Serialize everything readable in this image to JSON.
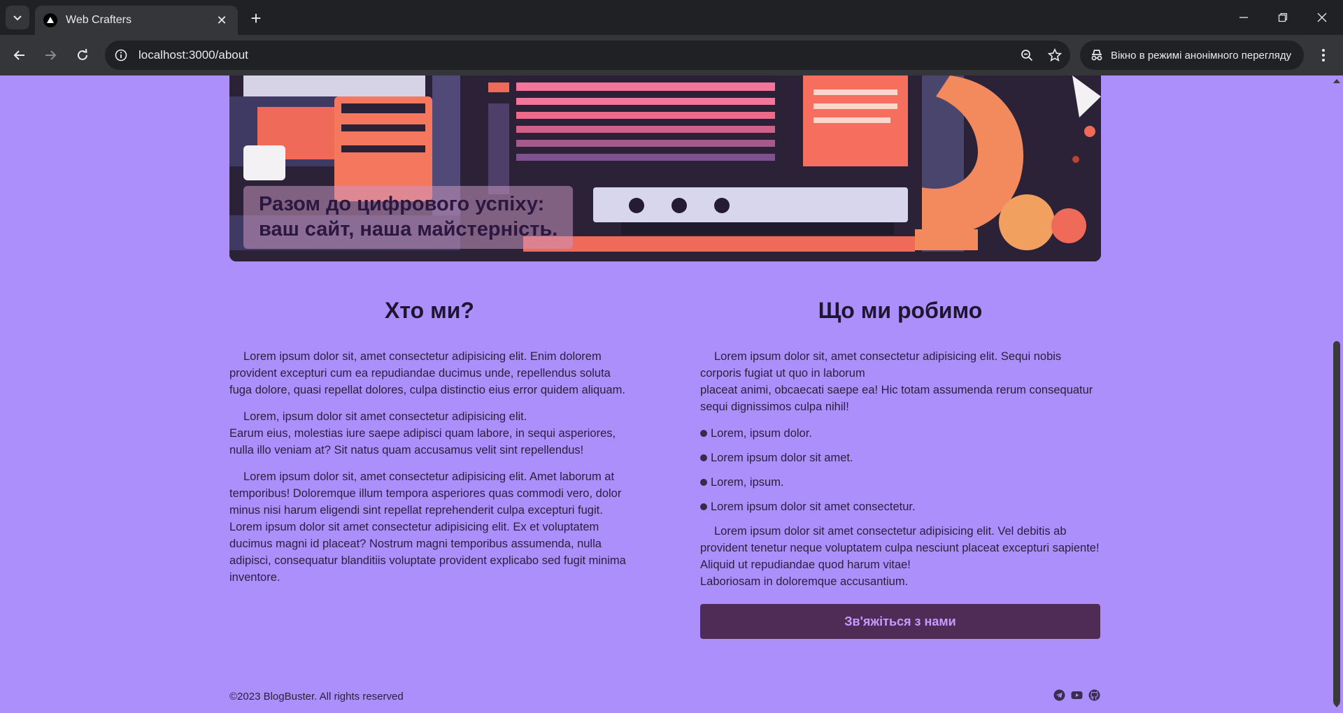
{
  "browser": {
    "tab_title": "Web Crafters",
    "url": "localhost:3000/about",
    "incognito_label": "Вікно в режимі анонімного перегляду"
  },
  "hero": {
    "line1": "Разом до цифрового успіху:",
    "line2": "ваш сайт, наша майстерність."
  },
  "who": {
    "heading": "Хто ми?",
    "paragraphs": [
      [
        "Lorem ipsum dolor sit, amet consectetur adipisicing elit. Enim dolorem provident excepturi cum ea repudiandae ducimus unde, repellendus soluta fuga dolore, quasi repellat dolores, culpa distinctio eius error quidem aliquam."
      ],
      [
        "Lorem, ipsum dolor sit amet consectetur adipisicing elit.",
        "Earum eius, molestias iure saepe adipisci quam labore, in sequi asperiores, nulla illo veniam at? Sit natus quam accusamus velit sint repellendus!"
      ],
      [
        "Lorem ipsum dolor sit, amet consectetur adipisicing elit. Amet laborum at temporibus! Doloremque illum tempora asperiores quas commodi vero, dolor minus nisi harum eligendi sint repellat reprehenderit culpa excepturi fugit. Lorem ipsum dolor sit amet consectetur adipisicing elit. Ex et voluptatem ducimus magni id placeat? Nostrum magni temporibus assumenda, nulla adipisci, consequatur blanditiis voluptate provident explicabo sed fugit minima inventore."
      ]
    ]
  },
  "what": {
    "heading": "Що ми робимо",
    "intro": [
      "Lorem ipsum dolor sit, amet consectetur adipisicing elit. Sequi nobis corporis fugiat ut quo in laborum",
      "placeat animi, obcaecati saepe ea! Hic totam assumenda rerum consequatur sequi dignissimos culpa nihil!"
    ],
    "bullets": [
      "Lorem, ipsum dolor.",
      "Lorem ipsum dolor sit amet.",
      "Lorem, ipsum.",
      "Lorem ipsum dolor sit amet consectetur."
    ],
    "outro": [
      "Lorem ipsum dolor sit amet consectetur adipisicing elit. Vel debitis ab provident tenetur neque voluptatem culpa nesciunt placeat excepturi sapiente! Aliquid ut repudiandae quod harum vitae!",
      "Laboriosam in doloremque accusantium."
    ],
    "button": "Зв'яжіться з нами"
  },
  "footer": {
    "copyright": "©2023 BlogBuster. All rights reserved"
  },
  "icons": [
    "telegram-icon",
    "youtube-icon",
    "github-icon"
  ]
}
